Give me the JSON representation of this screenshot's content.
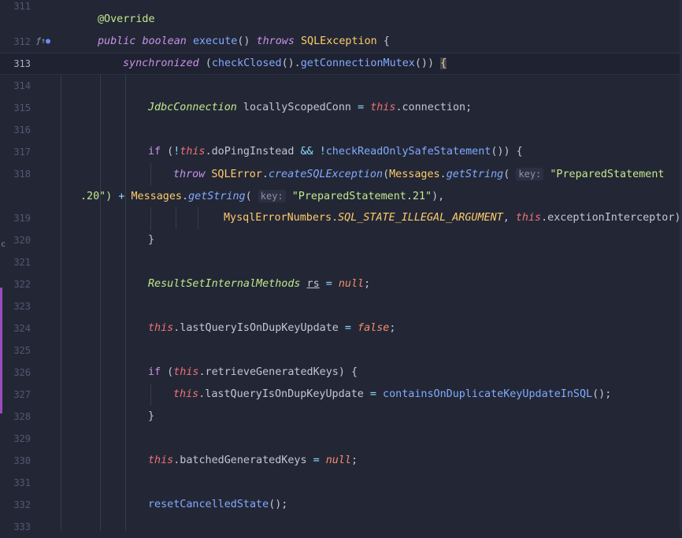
{
  "gutter": {
    "lines": [
      "311",
      "312",
      "313",
      "314",
      "315",
      "316",
      "317",
      "318",
      "319",
      "320",
      "321",
      "322",
      "323",
      "324",
      "325",
      "326",
      "327",
      "328",
      "329",
      "330",
      "331",
      "332",
      "333"
    ],
    "icons": {
      "override": "ƒ↑",
      "run": "●"
    },
    "marker_c": "c"
  },
  "code": {
    "l311": {
      "annotation": "@Override"
    },
    "l312": {
      "kw1": "public",
      "kw2": "boolean",
      "fn": "execute",
      "rest1": "() ",
      "kw3": "throws",
      "type": "SQLException",
      "rest2": " {"
    },
    "l313": {
      "kw": "synchronized",
      "rest1": " (",
      "fn1": "checkClosed",
      "rest2": "().",
      "fn2": "getConnectionMutex",
      "rest3": "()) ",
      "brace": "{"
    },
    "l315": {
      "type": "JdbcConnection",
      "rest1": " locallyScopedConn ",
      "op": "=",
      "sp": " ",
      "this": "this",
      "rest2": ".connection;"
    },
    "l317": {
      "kw": "if",
      "rest1": " (",
      "op1": "!",
      "this": "this",
      "rest2": ".doPingInstead ",
      "op2": "&&",
      "sp": " ",
      "op3": "!",
      "fn": "checkReadOnlySafeStatement",
      "rest3": "()) {"
    },
    "l318": {
      "kw": "throw",
      "type": "SQLError",
      "dot": ".",
      "fn": "createSQLException",
      "rest1": "(",
      "type2": "Messages",
      "dot2": ".",
      "fn2": "getString",
      "rest2": "( ",
      "hint": "key:",
      "str": " \"PreparedStatement"
    },
    "l318b": {
      "str": ".20\")",
      "op": " + ",
      "type": "Messages",
      "dot": ".",
      "fn": "getString",
      "rest1": "( ",
      "hint": "key:",
      "str2": " \"PreparedStatement.21\"",
      "rest2": "),"
    },
    "l319": {
      "type": "MysqlErrorNumbers",
      "dot": ".",
      "const": "SQL_STATE_ILLEGAL_ARGUMENT",
      "rest1": ", ",
      "this": "this",
      "rest2": ".exceptionInterceptor);"
    },
    "l320": {
      "brace": "}"
    },
    "l322": {
      "type": "ResultSetInternalMethods",
      "sp": " ",
      "var": "rs",
      "sp2": " ",
      "op": "=",
      "sp3": " ",
      "nul": "null",
      "semi": ";"
    },
    "l324": {
      "this": "this",
      "rest1": ".lastQueryIsOnDupKeyUpdate ",
      "op": "=",
      "sp": " ",
      "nul": "false",
      "semi": ";"
    },
    "l326": {
      "kw": "if",
      "rest1": " (",
      "this": "this",
      "rest2": ".retrieveGeneratedKeys) {"
    },
    "l327": {
      "this": "this",
      "rest1": ".lastQueryIsOnDupKeyUpdate ",
      "op": "=",
      "sp": " ",
      "fn": "containsOnDuplicateKeyUpdateInSQL",
      "rest2": "();"
    },
    "l328": {
      "brace": "}"
    },
    "l330": {
      "this": "this",
      "rest1": ".batchedGeneratedKeys ",
      "op": "=",
      "sp": " ",
      "nul": "null",
      "semi": ";"
    },
    "l332": {
      "fn": "resetCancelledState",
      "rest": "();"
    }
  },
  "colors": {
    "background": "#232735",
    "keyword": "#c792ea",
    "type": "#ffcb6b",
    "function": "#82aaff",
    "this": "#f07178",
    "string": "#c3e88d",
    "operator": "#89ddff",
    "literal": "#f78c6c"
  }
}
